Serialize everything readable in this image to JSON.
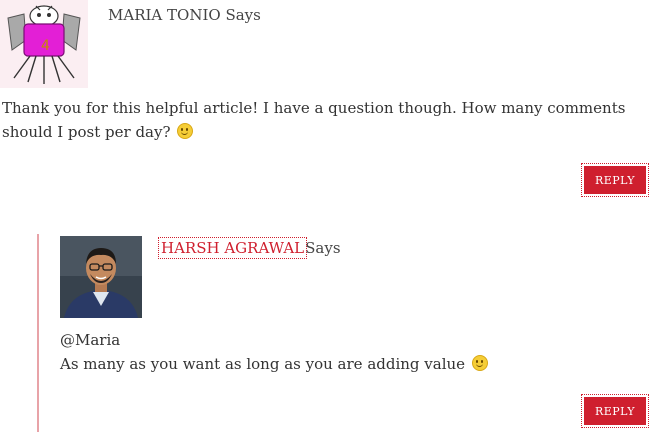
{
  "comments": [
    {
      "author": "MARIA TONIO",
      "says": " Says",
      "avatar_icon": "cartoon-monster-avatar",
      "body_text": "Thank you for this helpful article! I have a question though. How many comments should I post per day?",
      "emoji": "smiley",
      "reply_label": "REPLY"
    },
    {
      "author": "HARSH AGRAWAL",
      "says": "Says",
      "avatar_icon": "profile-photo-avatar",
      "body_line1": "@Maria",
      "body_line2": "As many as you want as long as you are adding value",
      "emoji": "smiley",
      "reply_label": "REPLY"
    }
  ],
  "colors": {
    "accent": "#cf1f2e",
    "thread_line": "#e8a3a8",
    "text": "#333333"
  }
}
